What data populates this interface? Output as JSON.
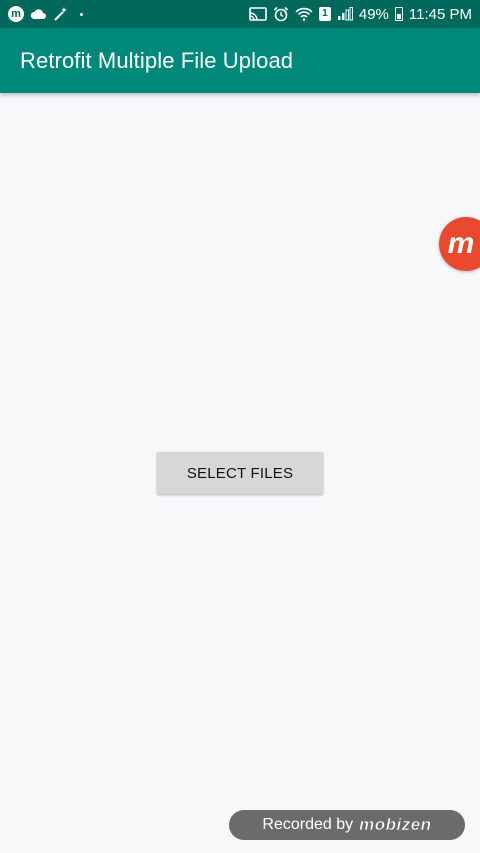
{
  "status_bar": {
    "battery_percent": "49%",
    "time": "11:45 PM",
    "battery_level": 0.49,
    "left_icons": [
      "mobizen-icon",
      "cloud-icon",
      "magic-wand-icon",
      "dot-icon"
    ],
    "right_icons": [
      "cast-icon",
      "alarm-icon",
      "wifi-icon",
      "sim-1-icon",
      "signal-icon",
      "battery-icon"
    ],
    "background_color": "#00695c"
  },
  "app_bar": {
    "title": "Retrofit Multiple File Upload",
    "background_color": "#00897b"
  },
  "main": {
    "select_files_label": "SELECT FILES",
    "background_color": "#f8f7fa"
  },
  "floating_bubble": {
    "glyph": "m",
    "color": "#e94a2f"
  },
  "watermark": {
    "recorded_by": "Recorded by",
    "brand": "mobizen"
  },
  "sim_badge": "1"
}
